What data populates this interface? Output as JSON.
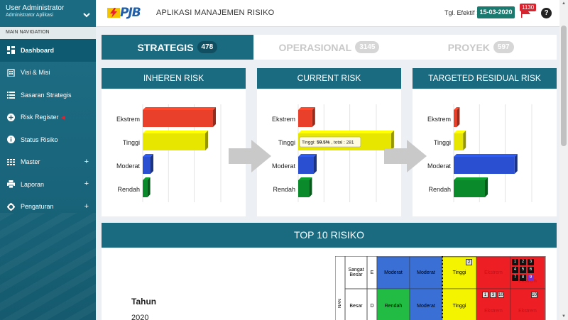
{
  "user": {
    "name": "User Administrator",
    "role": "Administrator Aplikasi"
  },
  "nav": {
    "header": "MAIN NAVIGATION",
    "items": [
      {
        "label": "Dashboard",
        "icon": "dashboard-icon"
      },
      {
        "label": "Visi & Misi",
        "icon": "building-icon"
      },
      {
        "label": "Sasaran Strategis",
        "icon": "list-icon"
      },
      {
        "label": "Risk Register",
        "icon": "plus-circle-icon"
      },
      {
        "label": "Status Risiko",
        "icon": "info-icon"
      },
      {
        "label": "Master",
        "icon": "table-icon"
      },
      {
        "label": "Laporan",
        "icon": "print-icon"
      },
      {
        "label": "Pengaturan",
        "icon": "gear-icon"
      }
    ],
    "expand_symbol": "+"
  },
  "header": {
    "logo_text": "PJB",
    "app_title": "APLIKASI MANAJEMEN RISIKO",
    "tgl_label": "Tgl. Efektif :",
    "tgl_value": "15-03-2020",
    "notif_count": "1130",
    "help_symbol": "?"
  },
  "tabs": [
    {
      "label": "STRATEGIS",
      "count": "478"
    },
    {
      "label": "OPERASIONAL",
      "count": "3145"
    },
    {
      "label": "PROYEK",
      "count": "597"
    }
  ],
  "panels": [
    {
      "title": "INHEREN RISK"
    },
    {
      "title": "CURRENT RISK"
    },
    {
      "title": "TARGETED RESIDUAL RISK"
    }
  ],
  "chart_data": [
    {
      "type": "bar",
      "title": "INHEREN RISK",
      "categories": [
        "Ekstrem",
        "Tinggi",
        "Moderat",
        "Rendah"
      ],
      "values": [
        45,
        40,
        5,
        3
      ],
      "colors": [
        "#e8402a",
        "#e6e600",
        "#2a4fd0",
        "#0a8a2a"
      ]
    },
    {
      "type": "bar",
      "title": "CURRENT RISK",
      "categories": [
        "Ekstrem",
        "Tinggi",
        "Moderat",
        "Rendah"
      ],
      "values": [
        9,
        59.5,
        10,
        7
      ],
      "colors": [
        "#e8402a",
        "#e6e600",
        "#2a4fd0",
        "#0a8a2a"
      ],
      "tooltip": {
        "label": "Tinggi:",
        "percent": "59.5%",
        "total_text": ", total : 281"
      }
    },
    {
      "type": "bar",
      "title": "TARGETED RESIDUAL RISK",
      "categories": [
        "Ekstrem",
        "Tinggi",
        "Moderat",
        "Rendah"
      ],
      "values": [
        2,
        6,
        39,
        20
      ],
      "colors": [
        "#e8402a",
        "#e6e600",
        "#2a4fd0",
        "#0a8a2a"
      ]
    }
  ],
  "top10": {
    "title": "TOP 10 RISIKO",
    "tahun_label": "Tahun",
    "tahun_value": "2020",
    "matrix": {
      "rows": [
        {
          "label": "Sangat Besar",
          "code": "E",
          "cells": [
            "Moderat",
            "Moderat",
            "Tinggi",
            "Ekstrem",
            "Ekstrem"
          ]
        },
        {
          "label": "Besar",
          "code": "D",
          "cells": [
            "Rendah",
            "Moderat",
            "Tinggi",
            "Ekstrem",
            "Ekstrem"
          ]
        }
      ],
      "side_label": "NAN",
      "row1_numbers": [
        "2",
        "1",
        "2",
        "3",
        "4",
        "5",
        "6",
        "7",
        "8",
        "9"
      ],
      "row2_numbers": [
        "1",
        "3",
        "10",
        "10"
      ],
      "colors": {
        "rendah": "#22bb44",
        "moderat": "#3a6fd6",
        "tinggi": "#f4f400",
        "ekstrem": "#ee1f24",
        "purple": "#7b2fd0"
      }
    }
  }
}
